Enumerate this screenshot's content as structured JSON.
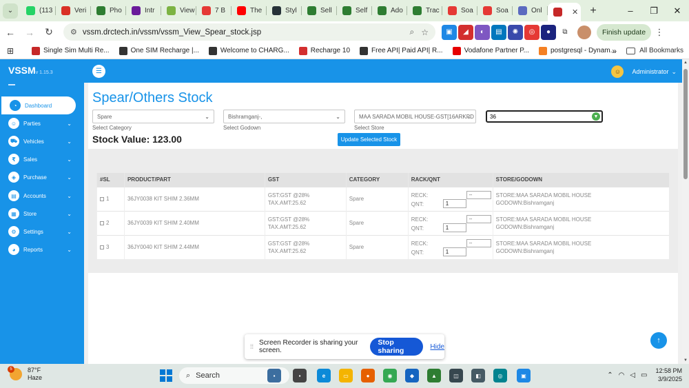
{
  "browser": {
    "tabs": [
      {
        "label": "(113",
        "color": "#25d366"
      },
      {
        "label": "Veri",
        "color": "#d93025"
      },
      {
        "label": "Pho",
        "color": "#2e7d32"
      },
      {
        "label": "Intr",
        "color": "#6a1b9a"
      },
      {
        "label": "View",
        "color": "#7cb342"
      },
      {
        "label": "7 B",
        "color": "#e53935"
      },
      {
        "label": "The",
        "color": "#ff0000"
      },
      {
        "label": "Styl",
        "color": "#263238"
      },
      {
        "label": "Sell",
        "color": "#2e7d32"
      },
      {
        "label": "Self",
        "color": "#2e7d32"
      },
      {
        "label": "Ado",
        "color": "#2e7d32"
      },
      {
        "label": "Trac",
        "color": "#2e7d32"
      },
      {
        "label": "Soa",
        "color": "#e53935"
      },
      {
        "label": "Soa",
        "color": "#e53935"
      },
      {
        "label": "Onl",
        "color": "#5c6bc0"
      }
    ],
    "active_tab_icon_color": "#c62828",
    "url": "vssm.drctech.in/vssm/vssm_View_Spear_stock.jsp",
    "finish_update": "Finish update",
    "bookmarks": [
      {
        "label": "Single Sim Multi Re...",
        "color": "#c62828"
      },
      {
        "label": "One SIM Recharge |...",
        "color": "#333333"
      },
      {
        "label": "Welcome to CHARG...",
        "color": "#333333"
      },
      {
        "label": "Recharge 10",
        "color": "#d32f2f"
      },
      {
        "label": "Free API| Paid API| R...",
        "color": "#333333"
      },
      {
        "label": "Vodafone Partner P...",
        "color": "#e60000"
      },
      {
        "label": "postgresql - Dynam...",
        "color": "#f48024"
      }
    ],
    "all_bookmarks": "All Bookmarks"
  },
  "app": {
    "brand": "VSSM",
    "version": "v 1.15.3",
    "admin": "Administrator",
    "sidebar": [
      {
        "label": "Dashboard",
        "icon": "dashboard-icon",
        "glyph": "◔",
        "active": true,
        "chevron": ""
      },
      {
        "label": "Parties",
        "icon": "people-icon",
        "glyph": "☺",
        "active": false,
        "chevron": "⌄"
      },
      {
        "label": "Vehicles",
        "icon": "car-icon",
        "glyph": "⛟",
        "active": false,
        "chevron": "⌄"
      },
      {
        "label": "Sales",
        "icon": "rupee-icon",
        "glyph": "₹",
        "active": false,
        "chevron": "⌄"
      },
      {
        "label": "Purchase",
        "icon": "bag-icon",
        "glyph": "◈",
        "active": false,
        "chevron": "⌄"
      },
      {
        "label": "Accounts",
        "icon": "accounts-icon",
        "glyph": "▤",
        "active": false,
        "chevron": "⌄"
      },
      {
        "label": "Store",
        "icon": "store-icon",
        "glyph": "▦",
        "active": false,
        "chevron": "⌄"
      },
      {
        "label": "Settings",
        "icon": "gear-icon",
        "glyph": "⚙",
        "active": false,
        "chevron": "⌄"
      },
      {
        "label": "Reports",
        "icon": "chart-icon",
        "glyph": "◕",
        "active": false,
        "chevron": "⌄"
      }
    ],
    "title": "Spear/Others Stock",
    "filters": {
      "category": {
        "value": "Spare",
        "label": "Select Category"
      },
      "godown": {
        "value": "Bishramganj-,",
        "label": "Select Godown"
      },
      "store": {
        "value": "MAA SARADA MOBIL HOUSE-GST[16ARKPD",
        "label": "Select Store"
      },
      "search": "36"
    },
    "stock_value": "Stock Value: 123.00",
    "update_button": "Update Selected Stock",
    "table": {
      "headers": [
        "#SL",
        "PRODUCT/PART",
        "GST",
        "CATEGORY",
        "RACK/QNT",
        "STORE/GODOWN"
      ],
      "rows": [
        {
          "sl": "1",
          "product": "36JY0038 KIT SHIM 2.36MM",
          "gst": "GST:GST @28%",
          "tax": "TAX.AMT:25.62",
          "category": "Spare",
          "reck_label": "RECK:",
          "qnt_label": "QNT:",
          "reck": "--",
          "qnt": "1",
          "store": "STORE:MAA SARADA MOBIL HOUSE",
          "godown": "GODOWN:Bishramganj"
        },
        {
          "sl": "2",
          "product": "36JY0039 KIT SHIM 2.40MM",
          "gst": "GST:GST @28%",
          "tax": "TAX.AMT:25.62",
          "category": "Spare",
          "reck_label": "RECK:",
          "qnt_label": "QNT:",
          "reck": "--",
          "qnt": "1",
          "store": "STORE:MAA SARADA MOBIL HOUSE",
          "godown": "GODOWN:Bishramganj"
        },
        {
          "sl": "3",
          "product": "36JY0040 KIT SHIM 2.44MM",
          "gst": "GST:GST @28%",
          "tax": "TAX.AMT:25.62",
          "category": "Spare",
          "reck_label": "RECK:",
          "qnt_label": "QNT:",
          "reck": "--",
          "qnt": "1",
          "store": "STORE:MAA SARADA MOBIL HOUSE",
          "godown": "GODOWN:Bishramganj"
        }
      ]
    }
  },
  "screen_share": {
    "message": "Screen Recorder is sharing your screen.",
    "stop": "Stop sharing",
    "hide": "Hide"
  },
  "taskbar": {
    "weather_badge": "5",
    "temp": "87°F",
    "condition": "Haze",
    "search": "Search",
    "time": "12:58 PM",
    "date": "3/9/2025",
    "apps": [
      {
        "name": "taskbar-app-1",
        "color": "#3c6e9f",
        "glyph": "▪"
      },
      {
        "name": "taskbar-app-2",
        "color": "#444444",
        "glyph": "▪"
      },
      {
        "name": "edge-icon",
        "color": "#0c8ad8",
        "glyph": "e"
      },
      {
        "name": "file-explorer-icon",
        "color": "#f4b400",
        "glyph": "▭"
      },
      {
        "name": "firefox-icon",
        "color": "#e66000",
        "glyph": "●"
      },
      {
        "name": "chrome-icon",
        "color": "#34a853",
        "glyph": "◉"
      },
      {
        "name": "taskbar-app-7",
        "color": "#1565c0",
        "glyph": "◆"
      },
      {
        "name": "taskbar-app-8",
        "color": "#2e7d32",
        "glyph": "▲"
      },
      {
        "name": "taskbar-app-9",
        "color": "#37474f",
        "glyph": "◫"
      },
      {
        "name": "taskbar-app-10",
        "color": "#455a64",
        "glyph": "◧"
      },
      {
        "name": "taskbar-app-11",
        "color": "#00838f",
        "glyph": "◎"
      },
      {
        "name": "taskbar-app-12",
        "color": "#1e88e5",
        "glyph": "▣"
      }
    ]
  }
}
